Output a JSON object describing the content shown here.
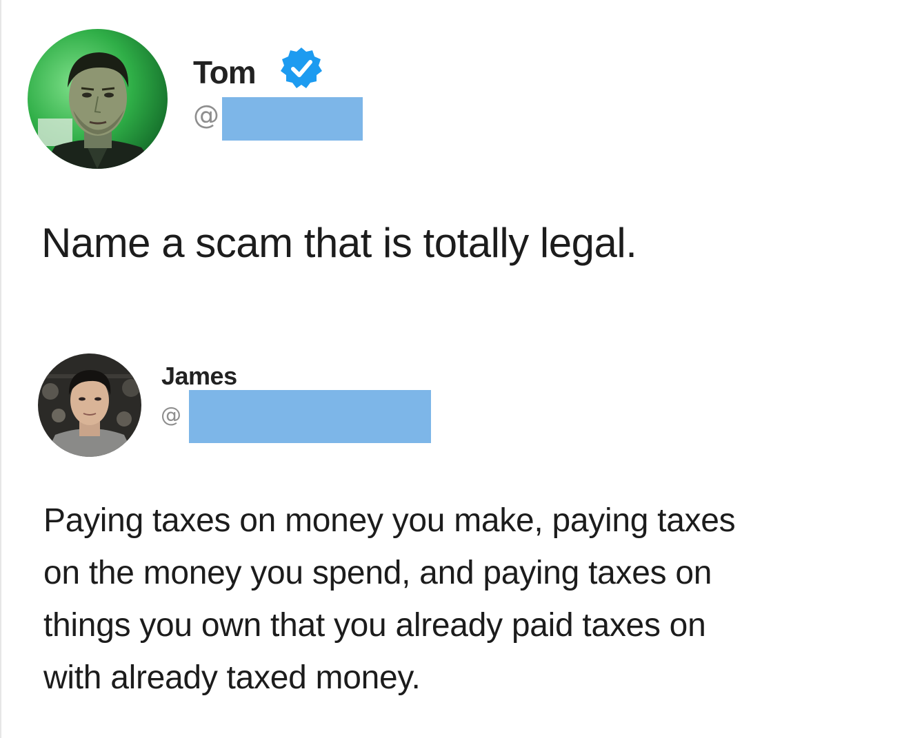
{
  "tweet": {
    "author": {
      "name": "Tom",
      "handle_prefix": "@",
      "verified_icon": "verified-check-icon",
      "avatar_icon": "profile-photo"
    },
    "text": "Name a scam that is totally legal."
  },
  "reply": {
    "author": {
      "name": "James",
      "handle_prefix": "@",
      "avatar_icon": "profile-photo"
    },
    "text_lines": [
      "Paying taxes on money you make, paying taxes",
      "on the money you spend, and paying taxes on",
      "things you own that you already paid taxes on",
      "with already taxed money."
    ]
  },
  "colors": {
    "redaction": "#7db6e8",
    "verified_blue": "#1d9bf0",
    "text": "#1c1c1c",
    "handle_gray": "#8e8e8e"
  }
}
